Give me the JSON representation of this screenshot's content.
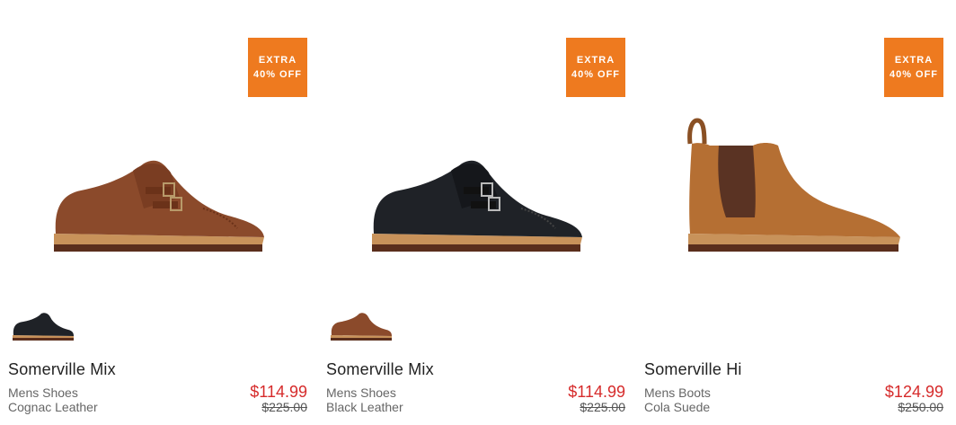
{
  "products": [
    {
      "badge_line1": "EXTRA",
      "badge_line2": "40% OFF",
      "name": "Somerville Mix",
      "category": "Mens Shoes",
      "color": "Cognac Leather",
      "sale_price": "$114.99",
      "original_price": "$225.00",
      "shoe_color": "#8b4a2b",
      "swatch_color": "#1f2227"
    },
    {
      "badge_line1": "EXTRA",
      "badge_line2": "40% OFF",
      "name": "Somerville Mix",
      "category": "Mens Shoes",
      "color": "Black Leather",
      "sale_price": "$114.99",
      "original_price": "$225.00",
      "shoe_color": "#1f2227",
      "swatch_color": "#8b4a2b"
    },
    {
      "badge_line1": "EXTRA",
      "badge_line2": "40% OFF",
      "name": "Somerville Hi",
      "category": "Mens Boots",
      "color": "Cola Suede",
      "sale_price": "$124.99",
      "original_price": "$250.00",
      "shoe_color": "#b56f33"
    }
  ],
  "colors": {
    "badge": "#ee7a1f",
    "sale_price": "#d62b2b"
  }
}
